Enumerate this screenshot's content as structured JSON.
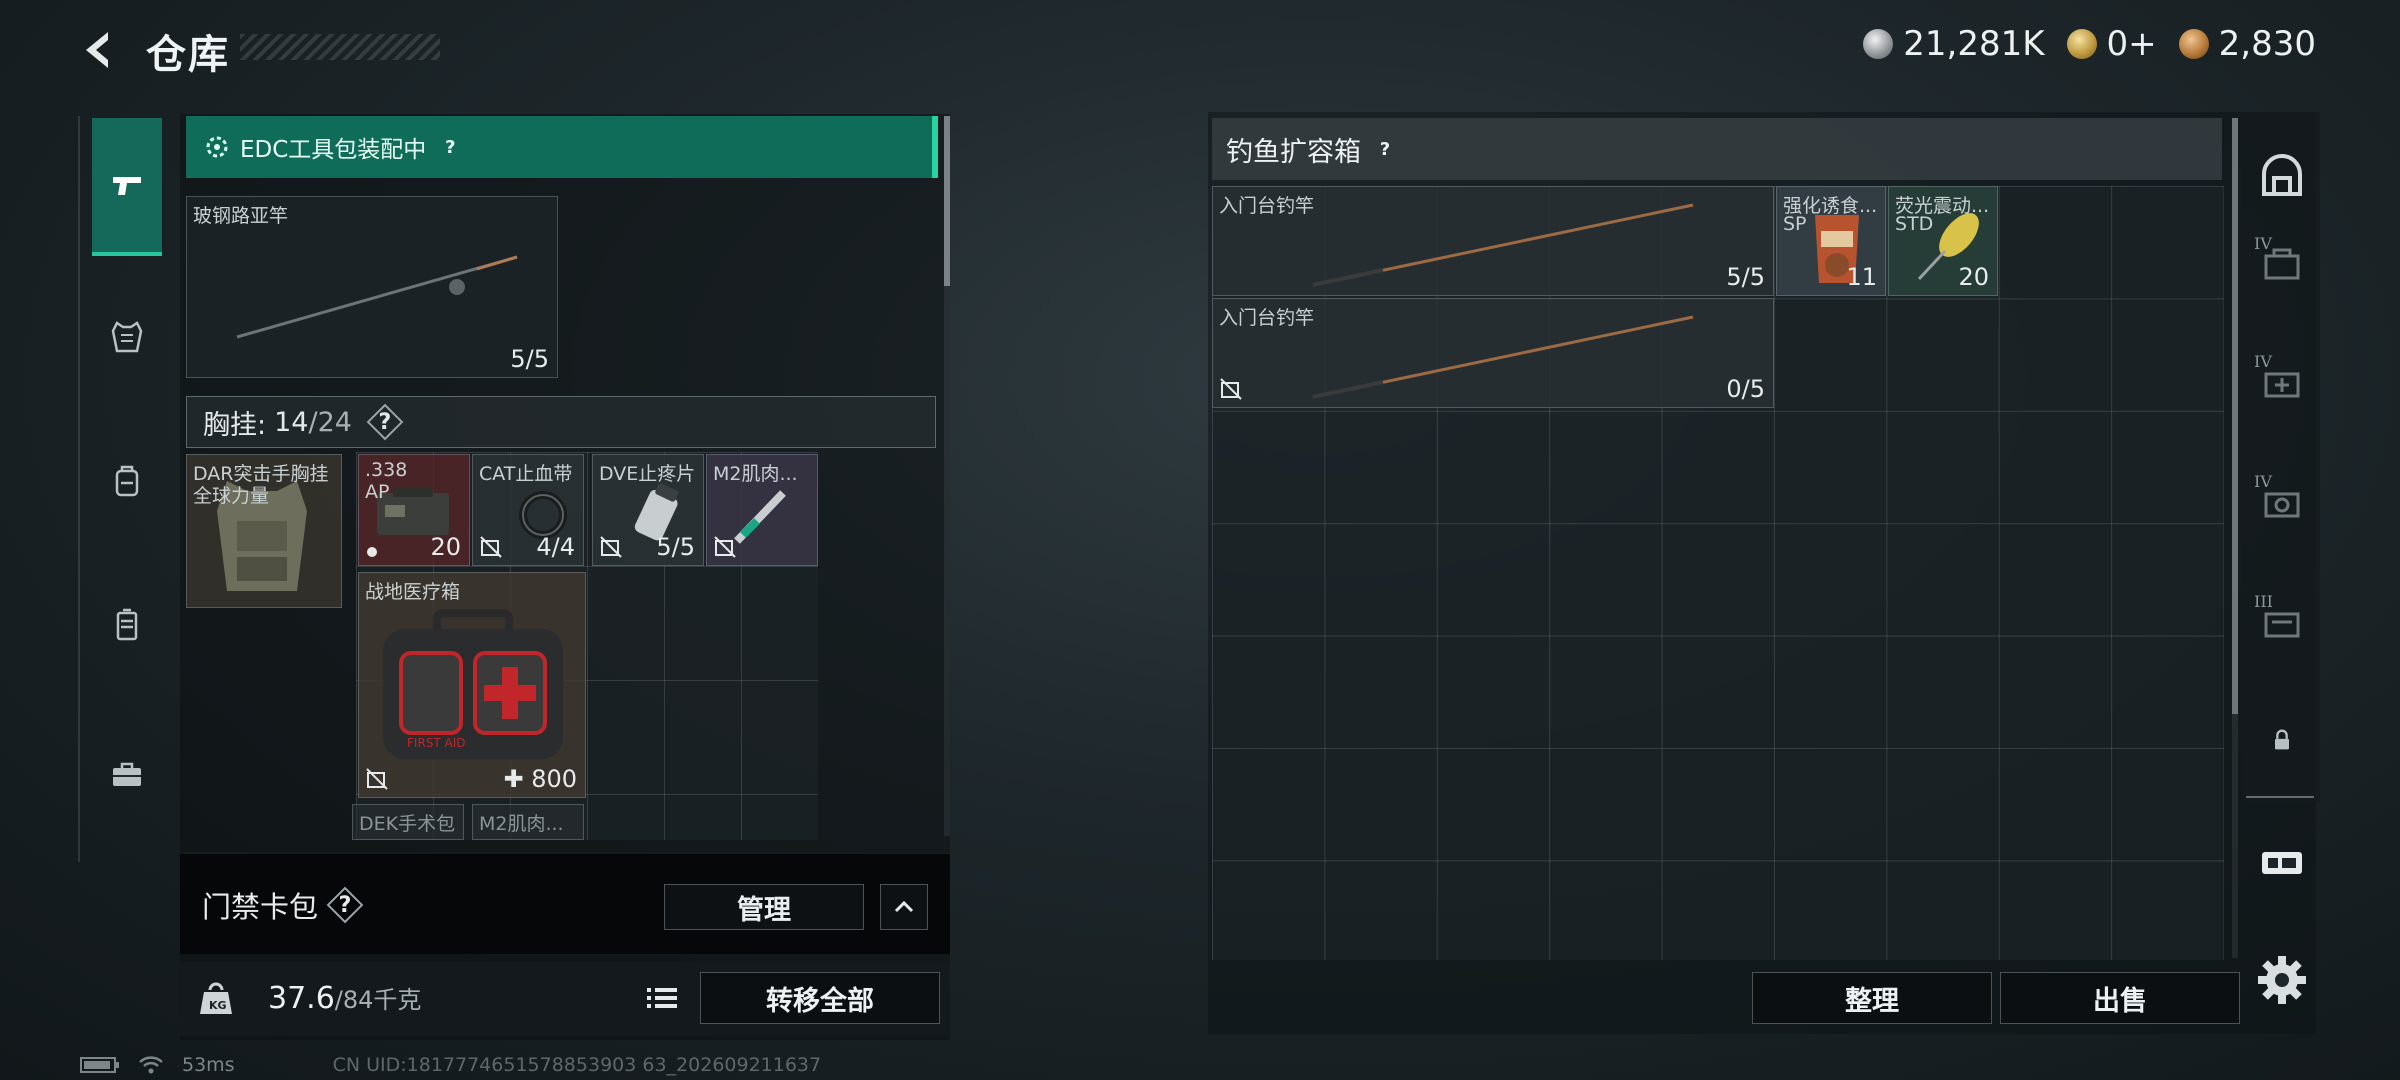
{
  "header": {
    "title": "仓库",
    "currencies": [
      {
        "icon": "silver-coin-icon",
        "value": "21,281K"
      },
      {
        "icon": "gold-coin-icon",
        "value": "0+"
      },
      {
        "icon": "bronze-coin-icon",
        "value": "2,830"
      }
    ]
  },
  "left_panel": {
    "edc_label": "EDC工具包装配中",
    "help": "?",
    "weapon": {
      "name": "玻钢路亚竿",
      "count": "5/5"
    },
    "chest_rig": {
      "label": "胸挂:",
      "used": "14",
      "capacity": "/24"
    },
    "chest_item": {
      "name_line1": "DAR突击手胸挂",
      "name_line2": "全球力量"
    },
    "items": [
      {
        "name": ".338",
        "sub": "AP",
        "count": "20"
      },
      {
        "name": "CAT止血带",
        "count": "4/4"
      },
      {
        "name": "DVE止疼片",
        "count": "5/5"
      },
      {
        "name": "M2肌肉...",
        "count": ""
      },
      {
        "name": "战地医疗箱",
        "count": "800"
      },
      {
        "name": "DEK手术包",
        "count": ""
      },
      {
        "name": "M2肌肉...",
        "count": ""
      }
    ],
    "access_card": {
      "label": "门禁卡包",
      "manage": "管理"
    },
    "weight": {
      "current": "37.6",
      "max": "/84千克"
    },
    "transfer_all": "转移全部"
  },
  "right_panel": {
    "title": "钓鱼扩容箱",
    "items": [
      {
        "name": "入门台钓竿",
        "count": "5/5"
      },
      {
        "name": "入门台钓竿",
        "count": "0/5"
      },
      {
        "name": "强化诱食...",
        "sub": "SP",
        "count": "11"
      },
      {
        "name": "荧光震动...",
        "sub": "STD",
        "count": "20"
      }
    ],
    "sort": "整理",
    "sell": "出售"
  },
  "right_rail": {
    "tiers": [
      "IV",
      "IV",
      "IV",
      "III"
    ]
  },
  "status_bar": {
    "ping": "53ms",
    "uid": "CN UID:1817774651578853903 63_202609211637"
  },
  "colors": {
    "accent_green": "#0f6c58",
    "accent_green_edge": "#27d3a1",
    "medkit_red": "#c0262a"
  }
}
